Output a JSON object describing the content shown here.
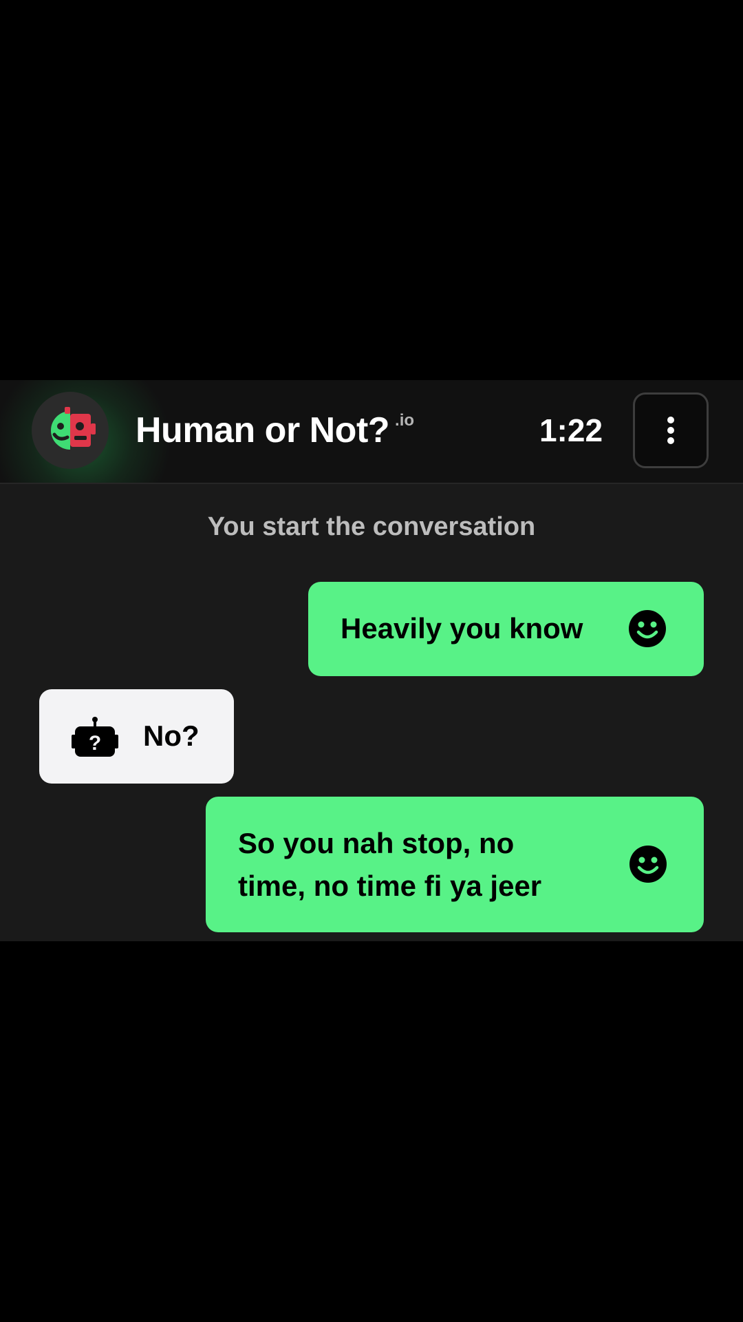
{
  "header": {
    "logo_name": "human-robot-face-logo",
    "title": "Human or Not?",
    "title_suffix": ".io",
    "timer": "1:22",
    "menu_icon": "more-vertical-icon"
  },
  "chat": {
    "system_message": "You start the conversation",
    "messages": [
      {
        "sender": "user",
        "text": "Heavily you know",
        "icon": "smiley-face-icon"
      },
      {
        "sender": "partner",
        "text": "No?",
        "icon": "robot-question-icon"
      },
      {
        "sender": "user",
        "text": "So you nah stop, no time, no time fi ya jeer",
        "icon": "smiley-face-icon"
      }
    ]
  },
  "colors": {
    "user_bubble": "#58f287",
    "partner_bubble": "#f3f3f5",
    "background": "#1a1a1a",
    "header": "#111111",
    "logo_human": "#3fdc74",
    "logo_robot": "#e0374a"
  }
}
